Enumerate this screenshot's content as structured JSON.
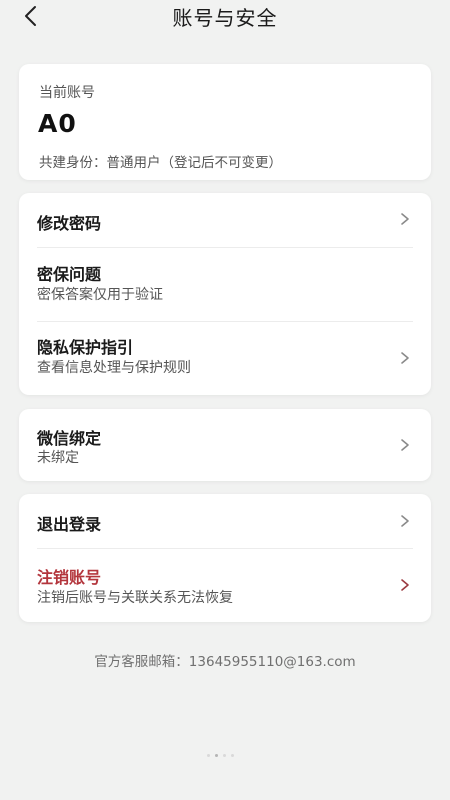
{
  "header": {
    "title": "账号与安全",
    "back_icon": "chevron-left-icon"
  },
  "account": {
    "label": "当前账号",
    "id": "A0",
    "role": "共建身份：普通用户（登记后不可变更）"
  },
  "security": {
    "items": [
      {
        "title": "修改密码",
        "subtitle": "",
        "chevron": true
      },
      {
        "title": "密保问题",
        "subtitle": "密保答案仅用于验证",
        "chevron": false
      },
      {
        "title": "隐私保护指引",
        "subtitle": "查看信息处理与保护规则",
        "chevron": true
      }
    ]
  },
  "wechat": {
    "title": "微信绑定",
    "subtitle": "未绑定"
  },
  "session": {
    "logout": "退出登录",
    "delete_title": "注销账号",
    "delete_subtitle": "注销后账号与关联关系无法恢复"
  },
  "footer": {
    "email": "官方客服邮箱：13645955110@163.com"
  },
  "colors": {
    "background": "#f1f2f1",
    "card": "#ffffff",
    "danger": "#b3353c",
    "text": "#1a1a1a",
    "muted": "#555555"
  }
}
